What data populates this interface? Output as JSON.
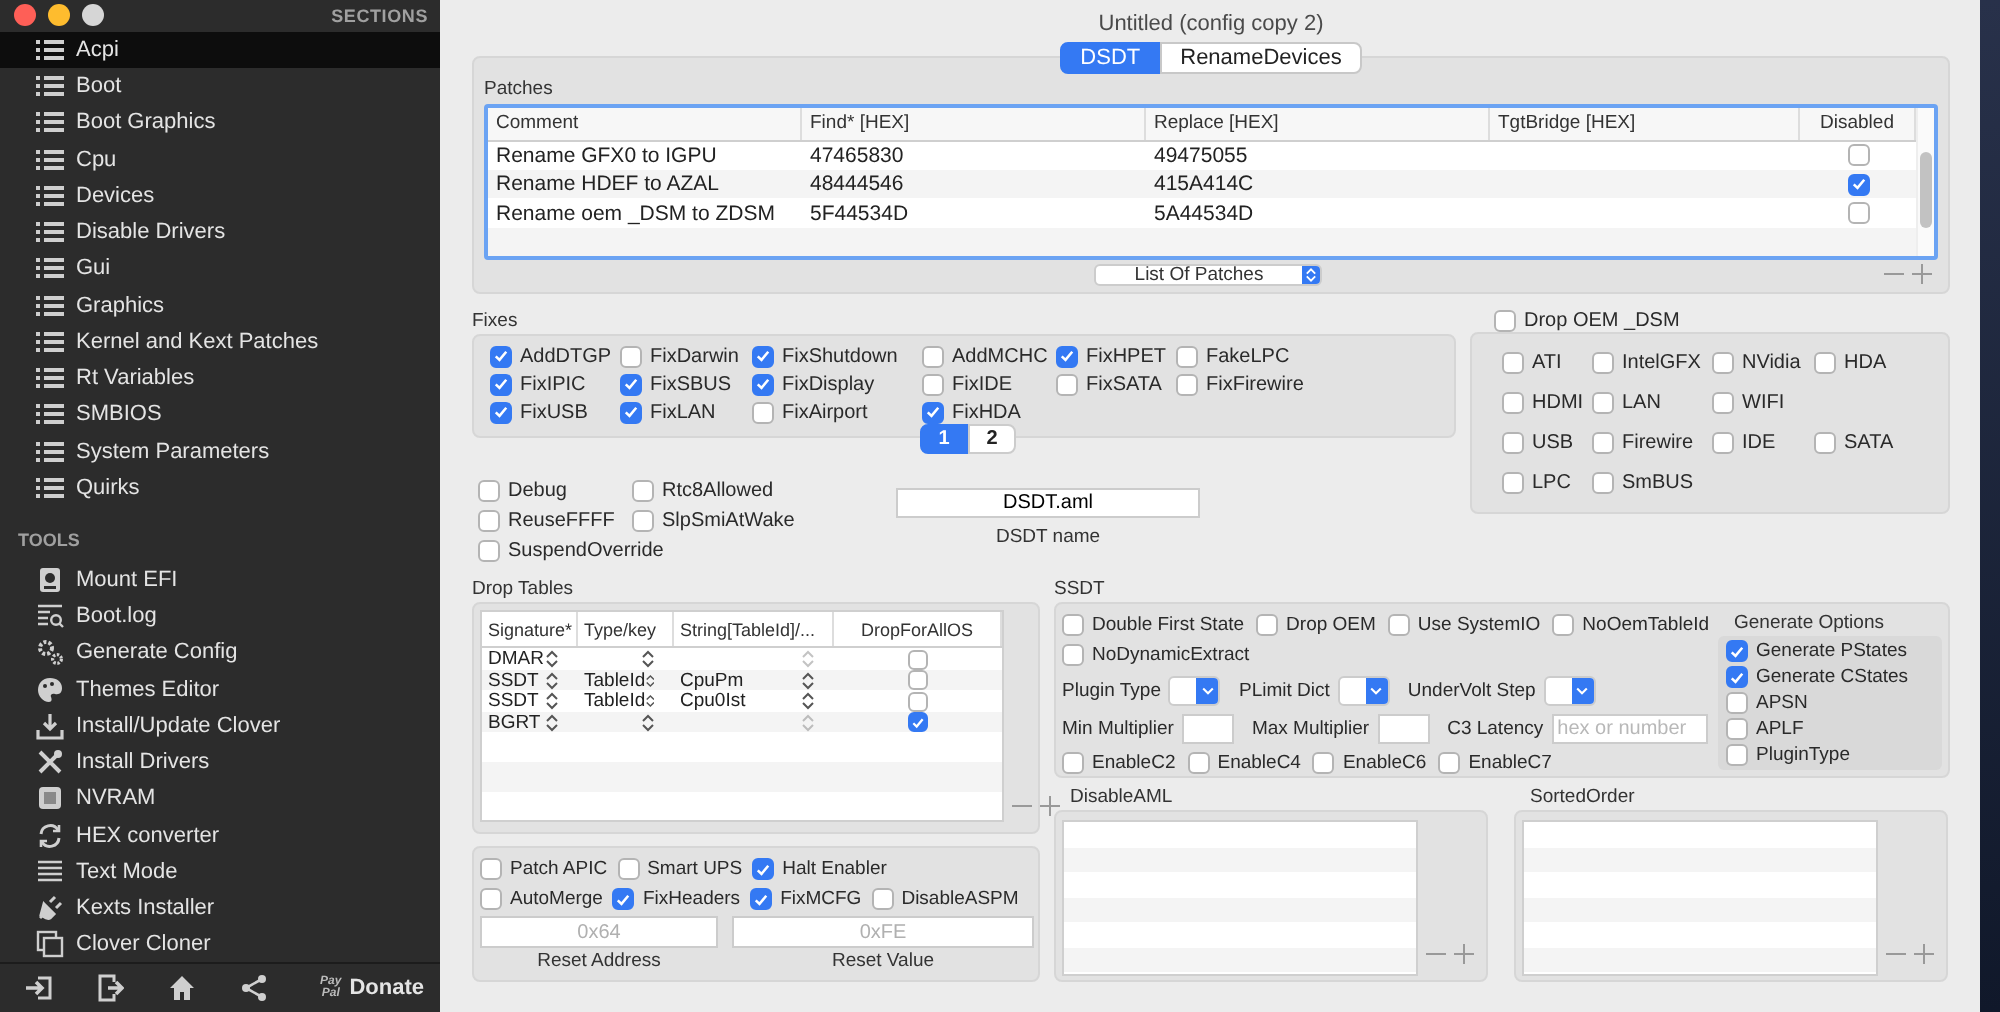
{
  "sidebar": {
    "sections_header": "SECTIONS",
    "sections": [
      {
        "label": "Acpi",
        "selected": true
      },
      {
        "label": "Boot",
        "selected": false
      },
      {
        "label": "Boot Graphics",
        "selected": false
      },
      {
        "label": "Cpu",
        "selected": false
      },
      {
        "label": "Devices",
        "selected": false
      },
      {
        "label": "Disable Drivers",
        "selected": false
      },
      {
        "label": "Gui",
        "selected": false
      },
      {
        "label": "Graphics",
        "selected": false
      },
      {
        "label": "Kernel and Kext Patches",
        "selected": false
      },
      {
        "label": "Rt Variables",
        "selected": false
      },
      {
        "label": "SMBIOS",
        "selected": false
      },
      {
        "label": "System Parameters",
        "selected": false
      },
      {
        "label": "Quirks",
        "selected": false
      }
    ],
    "tools_header": "TOOLS",
    "tools": [
      {
        "label": "Mount EFI",
        "kind": "disk"
      },
      {
        "label": "Boot.log",
        "kind": "log"
      },
      {
        "label": "Generate Config",
        "kind": "gears"
      },
      {
        "label": "Themes Editor",
        "kind": "palette"
      },
      {
        "label": "Install/Update Clover",
        "kind": "download"
      },
      {
        "label": "Install Drivers",
        "kind": "tools"
      },
      {
        "label": "NVRAM",
        "kind": "chip"
      },
      {
        "label": "HEX converter",
        "kind": "refresh"
      },
      {
        "label": "Text Mode",
        "kind": "lines"
      },
      {
        "label": "Kexts Installer",
        "kind": "plug"
      },
      {
        "label": "Clover Cloner",
        "kind": "copy"
      }
    ],
    "paypal": [
      "Pay",
      "Pal"
    ],
    "donate": "Donate"
  },
  "window": {
    "title": "Untitled (config copy 2)"
  },
  "tabs": [
    {
      "label": "DSDT",
      "selected": true
    },
    {
      "label": "RenameDevices",
      "selected": false
    }
  ],
  "patches": {
    "title": "Patches",
    "columns": [
      "Comment",
      "Find* [HEX]",
      "Replace [HEX]",
      "TgtBridge [HEX]",
      "Disabled"
    ],
    "rows": [
      {
        "comment": "Rename GFX0 to IGPU",
        "find": "47465830",
        "replace": "49475055",
        "disabled": false
      },
      {
        "comment": "Rename HDEF to AZAL",
        "find": "48444546",
        "replace": "415A414C",
        "disabled": true
      },
      {
        "comment": "Rename oem _DSM to ZDSM",
        "find": "5F44534D",
        "replace": "5A44534D",
        "disabled": false
      }
    ],
    "list_popup": "List Of Patches"
  },
  "fixes": {
    "title": "Fixes",
    "rows": [
      [
        {
          "label": "AddDTGP",
          "checked": true
        },
        {
          "label": "FixDarwin",
          "checked": false
        },
        {
          "label": "FixShutdown",
          "checked": true
        },
        {
          "label": "AddMCHC",
          "checked": false
        },
        {
          "label": "FixHPET",
          "checked": true
        },
        {
          "label": "FakeLPC",
          "checked": false
        }
      ],
      [
        {
          "label": "FixIPIC",
          "checked": true
        },
        {
          "label": "FixSBUS",
          "checked": true
        },
        {
          "label": "FixDisplay",
          "checked": true
        },
        {
          "label": "FixIDE",
          "checked": false
        },
        {
          "label": "FixSATA",
          "checked": false
        },
        {
          "label": "FixFirewire",
          "checked": false
        }
      ],
      [
        {
          "label": "FixUSB",
          "checked": true
        },
        {
          "label": "FixLAN",
          "checked": true
        },
        {
          "label": "FixAirport",
          "checked": false
        },
        {
          "label": "FixHDA",
          "checked": true
        }
      ]
    ],
    "pages": [
      {
        "label": "1",
        "selected": true
      },
      {
        "label": "2",
        "selected": false
      }
    ]
  },
  "options": [
    [
      {
        "label": "Debug",
        "checked": false
      },
      {
        "label": "Rtc8Allowed",
        "checked": false
      }
    ],
    [
      {
        "label": "ReuseFFFF",
        "checked": false
      },
      {
        "label": "SlpSmiAtWake",
        "checked": false
      }
    ],
    [
      {
        "label": "SuspendOverride",
        "checked": false
      }
    ]
  ],
  "dsdt_name": {
    "value": "DSDT.aml",
    "label": "DSDT name"
  },
  "drop_oem": {
    "label": "Drop OEM _DSM",
    "checked": false,
    "rows": [
      [
        {
          "label": "ATI",
          "checked": false
        },
        {
          "label": "IntelGFX",
          "checked": false
        },
        {
          "label": "NVidia",
          "checked": false
        },
        {
          "label": "HDA",
          "checked": false
        }
      ],
      [
        {
          "label": "HDMI",
          "checked": false
        },
        {
          "label": "LAN",
          "checked": false
        },
        {
          "label": "WIFI",
          "checked": false
        }
      ],
      [
        {
          "label": "USB",
          "checked": false
        },
        {
          "label": "Firewire",
          "checked": false
        },
        {
          "label": "IDE",
          "checked": false
        },
        {
          "label": "SATA",
          "checked": false
        }
      ],
      [
        {
          "label": "LPC",
          "checked": false
        },
        {
          "label": "SmBUS",
          "checked": false
        }
      ]
    ]
  },
  "drop_tables": {
    "title": "Drop Tables",
    "columns": [
      "Signature*",
      "Type/key",
      "String[TableId]/...",
      "DropForAllOS"
    ],
    "rows": [
      {
        "signature": "DMAR",
        "drop_for_all_os": false
      },
      {
        "signature": "SSDT",
        "type_key": "TableId",
        "string": "CpuPm",
        "drop_for_all_os": false
      },
      {
        "signature": "SSDT",
        "type_key": "TableId",
        "string": "Cpu0Ist",
        "drop_for_all_os": false
      },
      {
        "signature": "BGRT",
        "drop_for_all_os": true
      }
    ]
  },
  "acpi_flags": {
    "rows": [
      [
        {
          "label": "Patch APIC",
          "checked": false
        },
        {
          "label": "Smart UPS",
          "checked": false
        },
        {
          "label": "Halt Enabler",
          "checked": true
        }
      ],
      [
        {
          "label": "AutoMerge",
          "checked": false
        },
        {
          "label": "FixHeaders",
          "checked": true
        },
        {
          "label": "FixMCFG",
          "checked": true
        },
        {
          "label": "DisableASPM",
          "checked": false
        }
      ]
    ],
    "reset_address": {
      "placeholder": "0x64",
      "label": "Reset Address"
    },
    "reset_value": {
      "placeholder": "0xFE",
      "label": "Reset Value"
    }
  },
  "ssdt": {
    "title": "SSDT",
    "rows": [
      [
        {
          "label": "Double First State",
          "checked": false
        },
        {
          "label": "Drop OEM",
          "checked": false
        },
        {
          "label": "Use SystemIO",
          "checked": false
        },
        {
          "label": "NoOemTableId",
          "checked": false
        }
      ],
      [
        {
          "label": "NoDynamicExtract",
          "checked": false
        }
      ]
    ],
    "popups": [
      {
        "label": "Plugin Type"
      },
      {
        "label": "PLimit Dict"
      },
      {
        "label": "UnderVolt Step"
      }
    ],
    "fields": [
      {
        "label": "Min Multiplier"
      },
      {
        "label": "Max Multiplier"
      },
      {
        "label": "C3 Latency",
        "placeholder": "hex or number"
      }
    ],
    "enable": [
      {
        "label": "EnableC2",
        "checked": false
      },
      {
        "label": "EnableC4",
        "checked": false
      },
      {
        "label": "EnableC6",
        "checked": false
      },
      {
        "label": "EnableC7",
        "checked": false
      }
    ],
    "generate": {
      "title": "Generate Options",
      "items": [
        {
          "label": "Generate PStates",
          "checked": true
        },
        {
          "label": "Generate CStates",
          "checked": true
        },
        {
          "label": "APSN",
          "checked": false
        },
        {
          "label": "APLF",
          "checked": false
        },
        {
          "label": "PluginType",
          "checked": false
        }
      ]
    }
  },
  "disable_aml": {
    "title": "DisableAML"
  },
  "sorted_order": {
    "title": "SortedOrder"
  }
}
